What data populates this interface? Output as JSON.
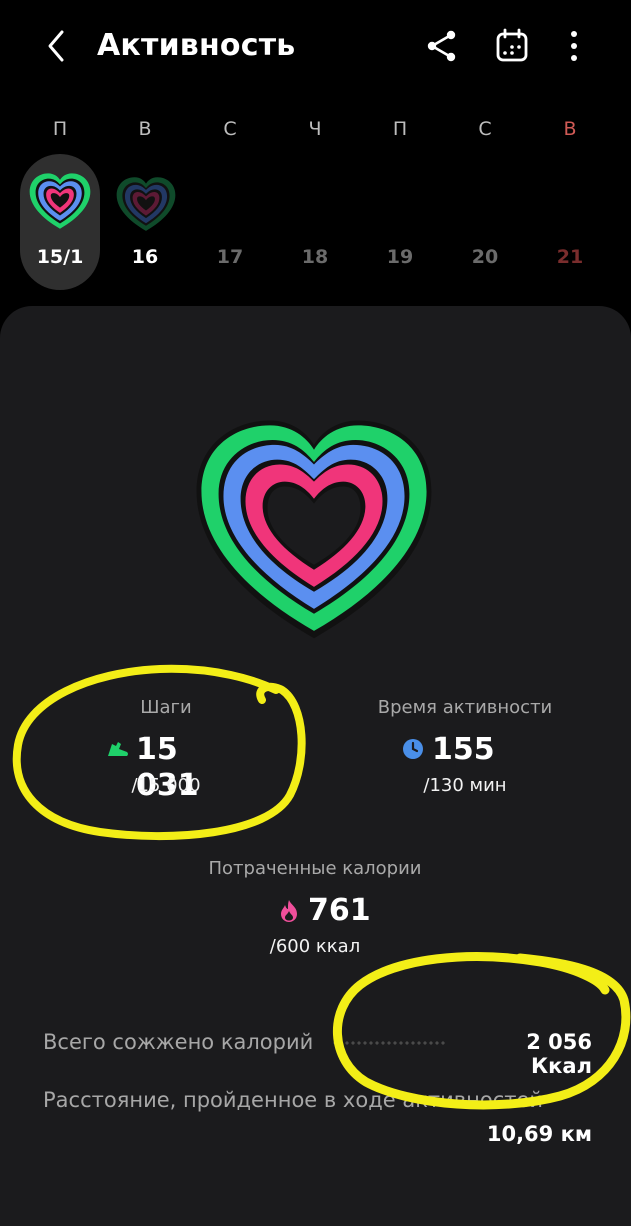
{
  "header": {
    "title": "Активность"
  },
  "week": {
    "days_of_week": [
      "П",
      "В",
      "С",
      "Ч",
      "П",
      "С",
      "В"
    ],
    "dates": [
      "15/1",
      "16",
      "17",
      "18",
      "19",
      "20",
      "21"
    ]
  },
  "steps": {
    "label": "Шаги",
    "value": "15 031",
    "goal": "/15 000"
  },
  "active_time": {
    "label": "Время активности",
    "value": "155",
    "goal": "/130 мин"
  },
  "calories": {
    "label": "Потраченные калории",
    "value": "761",
    "goal": "/600 ккал"
  },
  "summary": {
    "total_calories_label": "Всего сожжено калорий",
    "total_calories_value": "2 056 Ккал",
    "distance_label": "Расстояние, пройденное в ходе активностей",
    "distance_value": "10,69 км"
  },
  "colors": {
    "ring_green": "#1fd16a",
    "ring_blue": "#5b8ff0",
    "ring_pink": "#f0357a",
    "annotation": "#f3ee17"
  }
}
